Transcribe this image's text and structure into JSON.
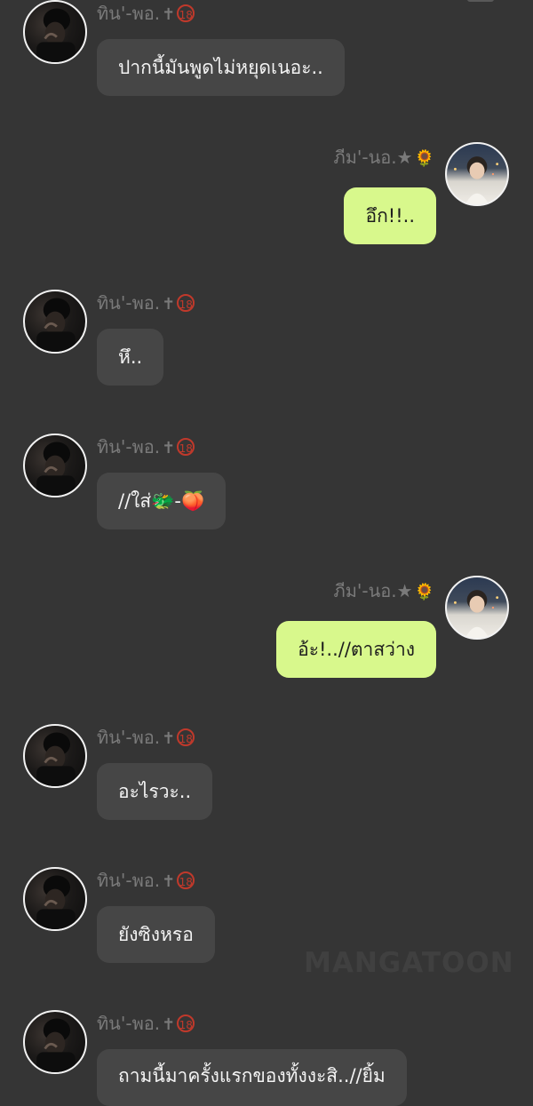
{
  "participants": {
    "tin": {
      "name": "ทิน'-พอ.",
      "symbol": "✝",
      "badge": "18"
    },
    "phim": {
      "name": "ภีม'-นอ.★",
      "badge": "🌻"
    }
  },
  "messages": [
    {
      "sender": "tin",
      "text": "ปากนี้มันพูดไม่หยุดเนอะ.."
    },
    {
      "sender": "phim",
      "text": "อึก!!.."
    },
    {
      "sender": "tin",
      "text": "หึ.."
    },
    {
      "sender": "tin",
      "text": "//ใส่🐲-🍑"
    },
    {
      "sender": "phim",
      "text": "อ้ะ!..//ตาสว่าง"
    },
    {
      "sender": "tin",
      "text": "อะไรวะ.."
    },
    {
      "sender": "tin",
      "text": "ยังซิงหรอ"
    },
    {
      "sender": "tin",
      "text": "ถามนี้มาครั้งแรกของทั้งงะสิ..//ยิ้ม"
    }
  ],
  "watermark": "MANGATOON"
}
